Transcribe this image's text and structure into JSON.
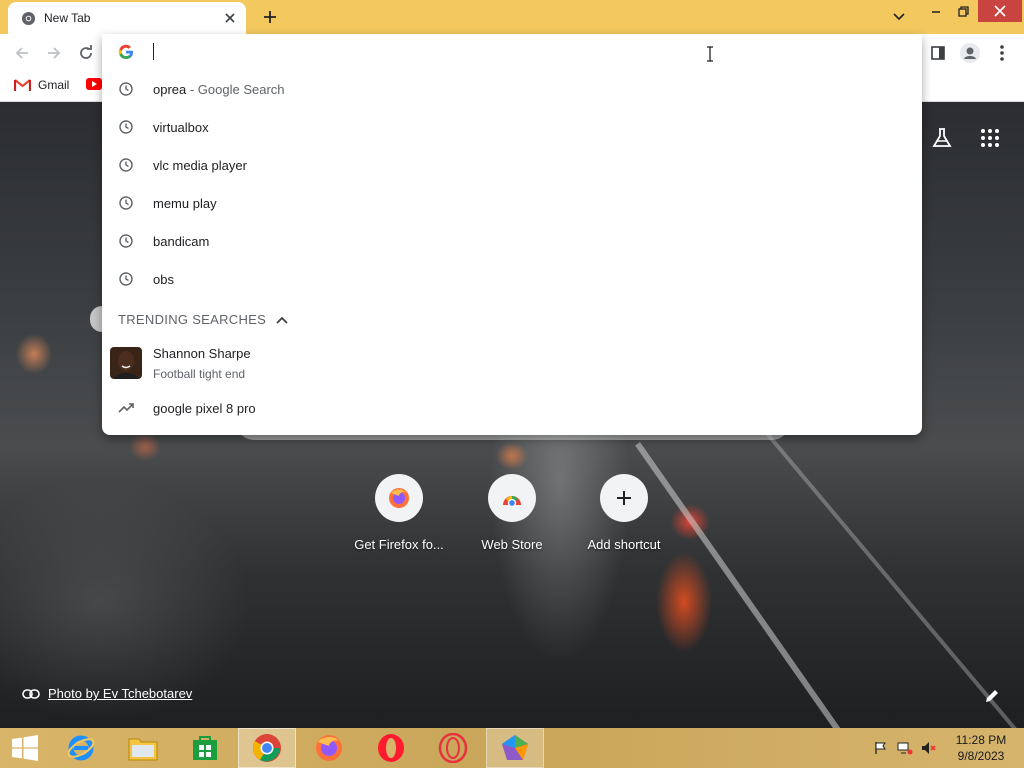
{
  "tab": {
    "title": "New Tab",
    "favicon": "chrome-icon"
  },
  "window_controls": [
    "minimize",
    "maximize",
    "close"
  ],
  "bookmarks": {
    "gmail_label": "Gmail"
  },
  "omnibox": {
    "value": "",
    "suggestions": [
      {
        "icon": "history-icon",
        "text": "oprea",
        "suffix": " - Google Search"
      },
      {
        "icon": "history-icon",
        "text": "virtualbox",
        "suffix": ""
      },
      {
        "icon": "history-icon",
        "text": "vlc media player",
        "suffix": ""
      },
      {
        "icon": "history-icon",
        "text": "memu play",
        "suffix": ""
      },
      {
        "icon": "history-icon",
        "text": "bandicam",
        "suffix": ""
      },
      {
        "icon": "history-icon",
        "text": "obs",
        "suffix": ""
      }
    ],
    "trending_header": "TRENDING SEARCHES",
    "trending_person": {
      "name": "Shannon Sharpe",
      "subtitle": "Football tight end"
    },
    "trending_query": "google pixel 8 pro"
  },
  "shortcuts": [
    {
      "label": "Get Firefox fo...",
      "icon": "firefox-icon"
    },
    {
      "label": "Web Store",
      "icon": "web-store-icon"
    },
    {
      "label": "Add shortcut",
      "icon": "plus-icon"
    }
  ],
  "attribution": "Photo by Ev Tchebotarev",
  "taskbar": {
    "apps": [
      "start",
      "internet-explorer",
      "file-explorer",
      "store",
      "chrome",
      "firefox",
      "opera",
      "opera-gx",
      "other-app"
    ],
    "clock_time": "11:28 PM",
    "clock_date": "9/8/2023"
  },
  "colors": {
    "titlebar": "#f2c85f",
    "close": "#c94340",
    "taskbar": "#d9b56a"
  }
}
